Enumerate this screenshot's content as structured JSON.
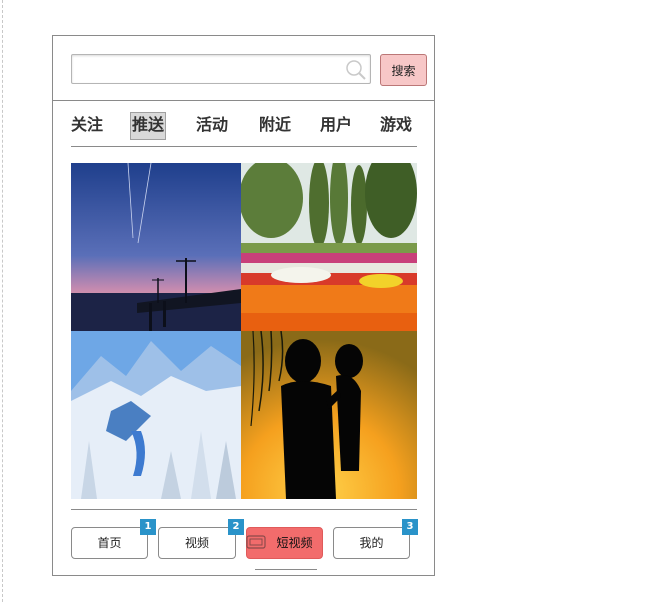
{
  "search": {
    "placeholder": "",
    "value": "",
    "button_label": "搜索"
  },
  "tabs": [
    {
      "label": "关注",
      "active": false
    },
    {
      "label": "推送",
      "active": true
    },
    {
      "label": "活动",
      "active": false
    },
    {
      "label": "附近",
      "active": false
    },
    {
      "label": "用户",
      "active": false
    },
    {
      "label": "游戏",
      "active": false
    }
  ],
  "feed": {
    "tiles": [
      {
        "subject": "sunset-pier-photo"
      },
      {
        "subject": "tulip-garden-photo"
      },
      {
        "subject": "snowy-mountains-photo"
      },
      {
        "subject": "parent-child-silhouette-photo"
      }
    ]
  },
  "bottom_nav": [
    {
      "label": "首页",
      "badge": "1"
    },
    {
      "label": "视频",
      "badge": "2"
    },
    {
      "label": "短视频",
      "active": true
    },
    {
      "label": "我的",
      "badge": "3"
    }
  ],
  "colors": {
    "accent": "#f26c6c",
    "search_button": "#f7c7c7",
    "badge": "#2a93c9",
    "border": "#8a8a8a"
  },
  "icons": [
    "search-icon",
    "video-icon"
  ]
}
